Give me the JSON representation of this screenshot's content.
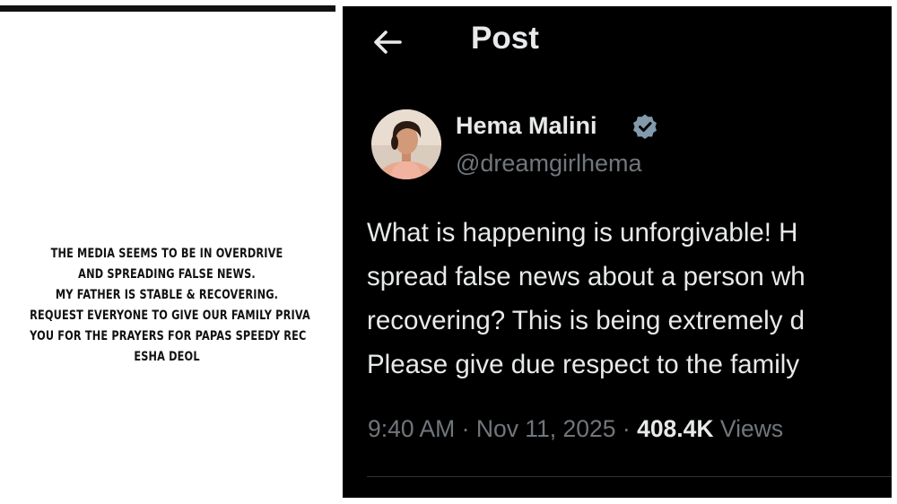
{
  "story": {
    "lines": [
      "THE MEDIA SEEMS TO BE IN OVERDRIVE",
      "AND SPREADING FALSE NEWS.",
      "MY FATHER IS STABLE & RECOVERING.",
      "REQUEST EVERYONE TO GIVE OUR FAMILY PRIVA",
      "YOU FOR THE PRAYERS FOR PAPAS SPEEDY REC",
      "ESHA DEOL"
    ]
  },
  "post": {
    "header_title": "Post",
    "back_icon": "arrow-left-icon",
    "author": {
      "name": "Hema Malini",
      "handle": "@dreamgirlhema",
      "verified_icon": "verified-badge-icon",
      "verified_color": "#829aab"
    },
    "text_lines": [
      "What is happening is unforgivable! H",
      "spread false news about a person wh",
      "recovering? This is being extremely d",
      "Please give due respect to the family"
    ],
    "time": "9:40 AM",
    "date": "Nov 11, 2025",
    "separator": "·",
    "views_count": "408.4K",
    "views_label": "Views"
  },
  "colors": {
    "background": "#000000",
    "text_primary": "#e7e9ea",
    "text_secondary": "#71767b"
  }
}
